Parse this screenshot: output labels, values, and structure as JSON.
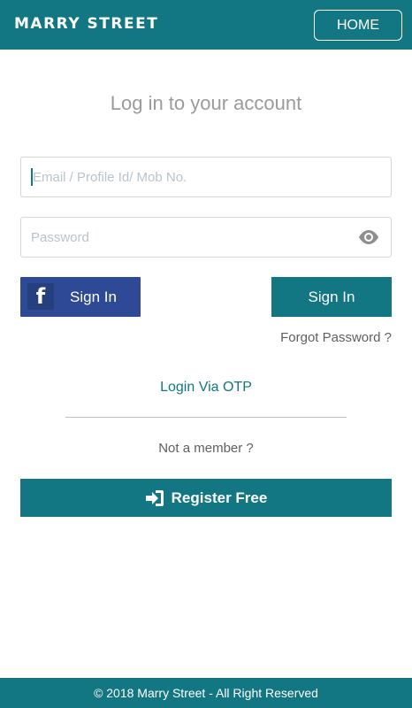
{
  "header": {
    "logo_text": "MARRY STREET",
    "home_label": "HOME"
  },
  "login": {
    "title": "Log in to your account",
    "email_placeholder": "Email / Profile Id/ Mob No.",
    "password_placeholder": "Password",
    "facebook_icon_letter": "f",
    "facebook_label": "Sign In",
    "signin_label": "Sign In",
    "forgot_label": "Forgot Password ?",
    "otp_label": "Login Via OTP",
    "not_member_text": "Not a member ?",
    "register_label": "Register Free"
  },
  "footer": {
    "copyright": "© 2018 Marry Street - All Right Reserved"
  },
  "colors": {
    "primary": "#127782",
    "facebook": "#2e4a96",
    "placeholder": "#b9c4cc"
  },
  "icons": [
    "eye-icon",
    "facebook-icon",
    "sign-in-arrow-icon"
  ]
}
